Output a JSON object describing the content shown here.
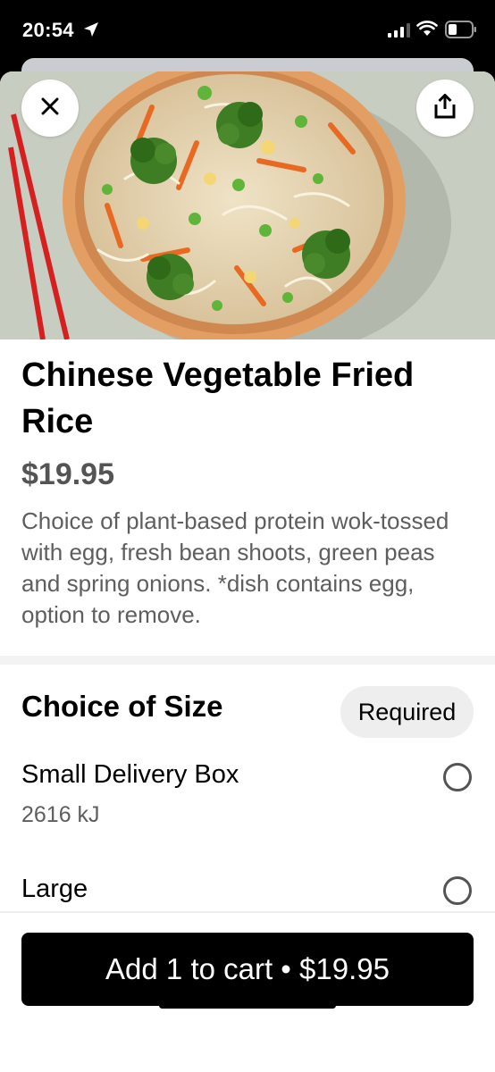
{
  "status_bar": {
    "time": "20:54",
    "icons": [
      "location-arrow-icon",
      "cellular-signal-icon",
      "wifi-icon",
      "battery-icon"
    ]
  },
  "header": {
    "close_icon": "close-icon",
    "share_icon": "share-icon"
  },
  "item": {
    "title": "Chinese Vegetable Fried Rice",
    "price": "$19.95",
    "description": "Choice of plant-based protein wok-tossed with egg, fresh bean shoots, green peas and spring onions. *dish contains egg, option to remove."
  },
  "size_section": {
    "title": "Choice of Size",
    "badge": "Required",
    "options": [
      {
        "name": "Small Delivery Box",
        "sub": "2616 kJ",
        "selected": false
      },
      {
        "name": "Large",
        "sub": "",
        "selected": false
      }
    ]
  },
  "footer": {
    "cart_button": "Add 1 to cart • $19.95"
  },
  "colors": {
    "primary": "#000000",
    "price": "#545454",
    "secondary_text": "#5e5e5e",
    "badge_bg": "#eeeeee",
    "chopsticks": "#d62020"
  }
}
